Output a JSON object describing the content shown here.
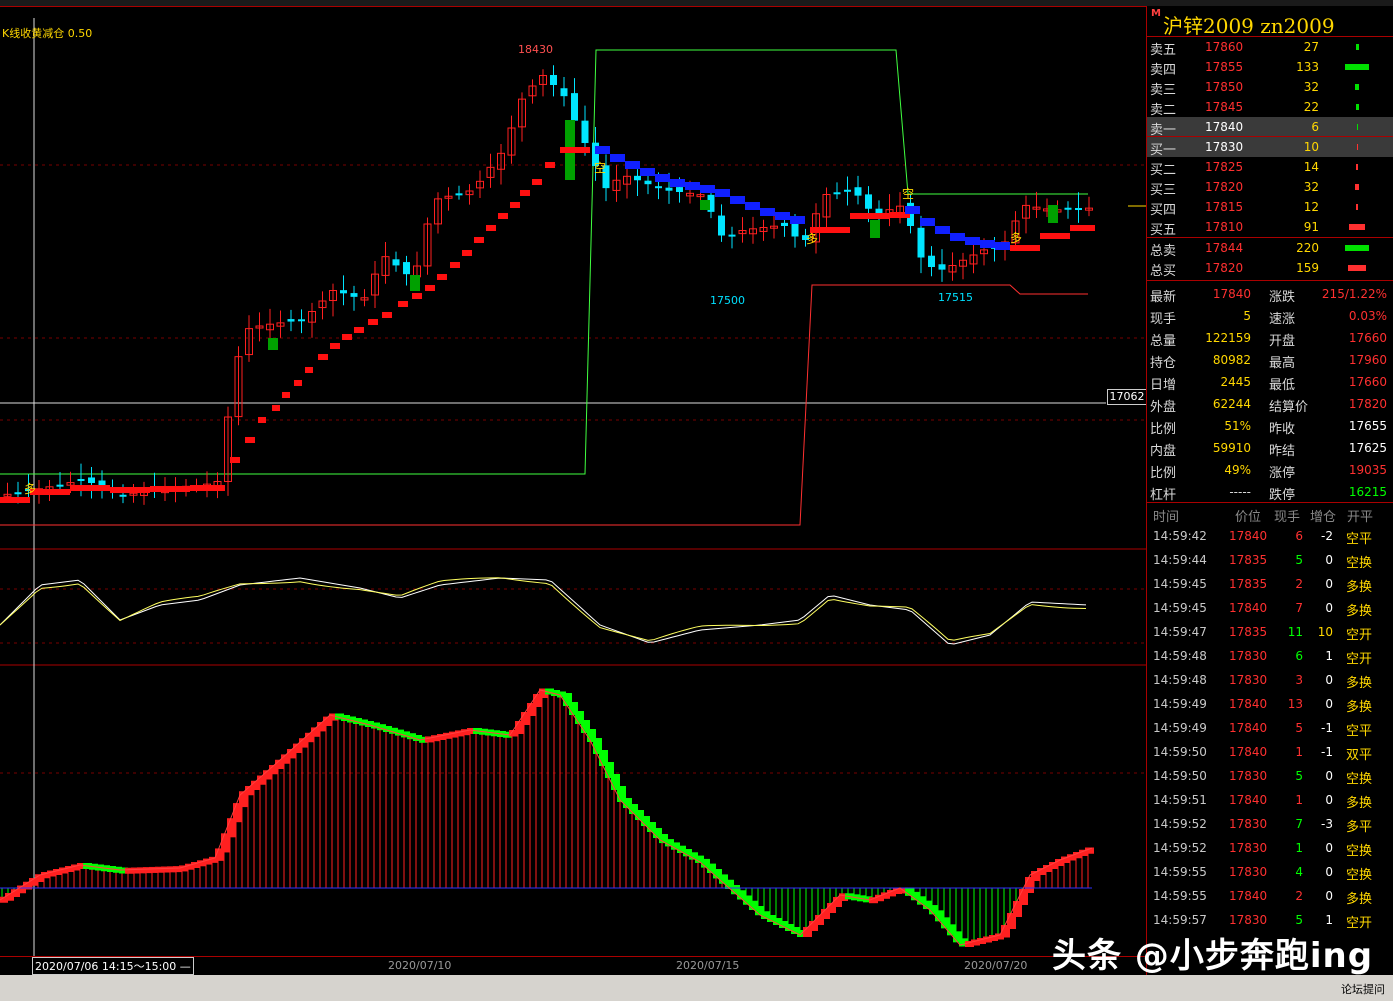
{
  "chart": {
    "indicator_label": "K线收黄减仓 0.50",
    "high_label": "18430",
    "low_label_1": "17500",
    "low_label_2": "17515",
    "cursor_price": "17062",
    "signal_long": "多",
    "signal_short": "空",
    "dates": [
      "2020/07/10",
      "2020/07/15",
      "2020/07/20"
    ],
    "selected_time": "2020/07/06 14:15～15:00 —"
  },
  "chart_data": {
    "type": "candlestick",
    "title": "沪锌2009 zn2009",
    "y_marks": {
      "high": 18430,
      "low1": 17500,
      "low2": 17515,
      "cursor": 17062
    },
    "x_ticks": [
      "2020/07/10",
      "2020/07/15",
      "2020/07/20"
    ]
  },
  "panel": {
    "title_mark": "M",
    "title": "沪锌2009  zn2009",
    "asks": [
      {
        "label": "卖五",
        "price": "17860",
        "vol": "27",
        "bar": 3
      },
      {
        "label": "卖四",
        "price": "17855",
        "vol": "133",
        "bar": 24
      },
      {
        "label": "卖三",
        "price": "17850",
        "vol": "32",
        "bar": 4
      },
      {
        "label": "卖二",
        "price": "17845",
        "vol": "22",
        "bar": 3
      },
      {
        "label": "卖一",
        "price": "17840",
        "vol": "6",
        "bar": 1
      }
    ],
    "bids": [
      {
        "label": "买一",
        "price": "17830",
        "vol": "10",
        "bar": 1
      },
      {
        "label": "买二",
        "price": "17825",
        "vol": "14",
        "bar": 2
      },
      {
        "label": "买三",
        "price": "17820",
        "vol": "32",
        "bar": 4
      },
      {
        "label": "买四",
        "price": "17815",
        "vol": "12",
        "bar": 2
      },
      {
        "label": "买五",
        "price": "17810",
        "vol": "91",
        "bar": 16
      }
    ],
    "total_sell": {
      "label": "总卖",
      "price": "17844",
      "vol": "220"
    },
    "total_buy": {
      "label": "总买",
      "price": "17820",
      "vol": "159"
    },
    "stats": [
      {
        "l1": "最新",
        "v1": "17840",
        "c1": "red",
        "l2": "涨跌",
        "v2": "215/1.22%",
        "c2": "red"
      },
      {
        "l1": "现手",
        "v1": "5",
        "c1": "yel",
        "l2": "速涨",
        "v2": "0.03%",
        "c2": "red"
      },
      {
        "l1": "总量",
        "v1": "122159",
        "c1": "yel",
        "l2": "开盘",
        "v2": "17660",
        "c2": "red"
      },
      {
        "l1": "持仓",
        "v1": "80982",
        "c1": "yel",
        "l2": "最高",
        "v2": "17960",
        "c2": "red"
      },
      {
        "l1": "日增",
        "v1": "2445",
        "c1": "yel",
        "l2": "最低",
        "v2": "17660",
        "c2": "red"
      },
      {
        "l1": "外盘",
        "v1": "62244",
        "c1": "yel",
        "l2": "结算价",
        "v2": "17820",
        "c2": "red"
      },
      {
        "l1": "比例",
        "v1": "51%",
        "c1": "yel",
        "l2": "昨收",
        "v2": "17655",
        "c2": "wht"
      },
      {
        "l1": "内盘",
        "v1": "59910",
        "c1": "yel",
        "l2": "昨结",
        "v2": "17625",
        "c2": "wht"
      },
      {
        "l1": "比例",
        "v1": "49%",
        "c1": "yel",
        "l2": "涨停",
        "v2": "19035",
        "c2": "red"
      },
      {
        "l1": "杠杆",
        "v1": "-----",
        "c1": "lbl",
        "l2": "跌停",
        "v2": "16215",
        "c2": "grn"
      }
    ],
    "tick_headers": [
      "时间",
      "价位",
      "现手",
      "增仓",
      "开平"
    ],
    "ticks": [
      {
        "t": "14:59:42",
        "p": "17840",
        "pc": "red",
        "v": "6",
        "vc": "red",
        "d": "-2",
        "dc": "wht",
        "k": "空平"
      },
      {
        "t": "14:59:44",
        "p": "17835",
        "pc": "red",
        "v": "5",
        "vc": "grn",
        "d": "0",
        "dc": "wht",
        "k": "空换"
      },
      {
        "t": "14:59:45",
        "p": "17835",
        "pc": "red",
        "v": "2",
        "vc": "red",
        "d": "0",
        "dc": "wht",
        "k": "多换"
      },
      {
        "t": "14:59:45",
        "p": "17840",
        "pc": "red",
        "v": "7",
        "vc": "red",
        "d": "0",
        "dc": "wht",
        "k": "多换"
      },
      {
        "t": "14:59:47",
        "p": "17835",
        "pc": "red",
        "v": "11",
        "vc": "grn",
        "d": "10",
        "dc": "yel",
        "k": "空开"
      },
      {
        "t": "14:59:48",
        "p": "17830",
        "pc": "red",
        "v": "6",
        "vc": "grn",
        "d": "1",
        "dc": "wht",
        "k": "空开"
      },
      {
        "t": "14:59:48",
        "p": "17830",
        "pc": "red",
        "v": "3",
        "vc": "red",
        "d": "0",
        "dc": "wht",
        "k": "多换"
      },
      {
        "t": "14:59:49",
        "p": "17840",
        "pc": "red",
        "v": "13",
        "vc": "red",
        "d": "0",
        "dc": "wht",
        "k": "多换"
      },
      {
        "t": "14:59:49",
        "p": "17840",
        "pc": "red",
        "v": "5",
        "vc": "red",
        "d": "-1",
        "dc": "wht",
        "k": "空平"
      },
      {
        "t": "14:59:50",
        "p": "17840",
        "pc": "red",
        "v": "1",
        "vc": "red",
        "d": "-1",
        "dc": "wht",
        "k": "双平"
      },
      {
        "t": "14:59:50",
        "p": "17830",
        "pc": "red",
        "v": "5",
        "vc": "grn",
        "d": "0",
        "dc": "wht",
        "k": "空换"
      },
      {
        "t": "14:59:51",
        "p": "17840",
        "pc": "red",
        "v": "1",
        "vc": "red",
        "d": "0",
        "dc": "wht",
        "k": "多换"
      },
      {
        "t": "14:59:52",
        "p": "17830",
        "pc": "red",
        "v": "7",
        "vc": "grn",
        "d": "-3",
        "dc": "wht",
        "k": "多平"
      },
      {
        "t": "14:59:52",
        "p": "17830",
        "pc": "red",
        "v": "1",
        "vc": "grn",
        "d": "0",
        "dc": "wht",
        "k": "空换"
      },
      {
        "t": "14:59:55",
        "p": "17830",
        "pc": "red",
        "v": "4",
        "vc": "grn",
        "d": "0",
        "dc": "wht",
        "k": "空换"
      },
      {
        "t": "14:59:55",
        "p": "17840",
        "pc": "red",
        "v": "2",
        "vc": "red",
        "d": "0",
        "dc": "wht",
        "k": "多换"
      },
      {
        "t": "14:59:57",
        "p": "17830",
        "pc": "red",
        "v": "5",
        "vc": "grn",
        "d": "1",
        "dc": "wht",
        "k": "空开"
      }
    ]
  },
  "watermark": "头条 @小步奔跑ing",
  "forum_button": "论坛提问"
}
